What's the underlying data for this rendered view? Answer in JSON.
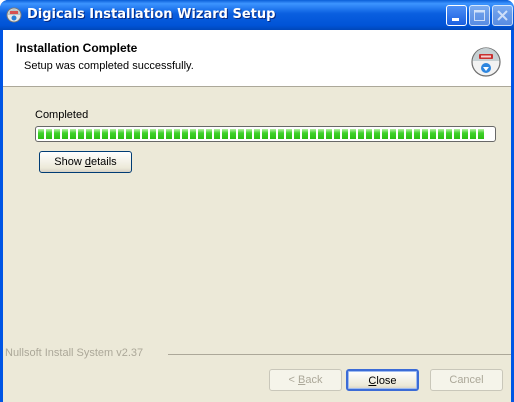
{
  "window": {
    "title": "Digicals Installation Wizard Setup",
    "icon": "installer-globe-icon",
    "title_buttons": [
      "minimize-icon",
      "maximize-icon",
      "close-icon"
    ]
  },
  "header": {
    "title": "Installation Complete",
    "subtitle": "Setup was completed successfully.",
    "icon": "installer-globe-icon"
  },
  "progress": {
    "label": "Completed",
    "value": 1.0,
    "color": "#2bbf12"
  },
  "buttons": {
    "show_details": {
      "prefix": "Show ",
      "mnemonic": "d",
      "suffix": "etails"
    },
    "back": {
      "prefix": "< ",
      "mnemonic": "B",
      "suffix": "ack"
    },
    "close": {
      "prefix": "",
      "mnemonic": "C",
      "suffix": "lose"
    },
    "cancel": "Cancel"
  },
  "footer": {
    "brand": "Nullsoft Install System v2.37"
  },
  "colors": {
    "titlebar": "#0055e5",
    "dialog_bg": "#ece9d8",
    "accent_border": "#003c74"
  }
}
